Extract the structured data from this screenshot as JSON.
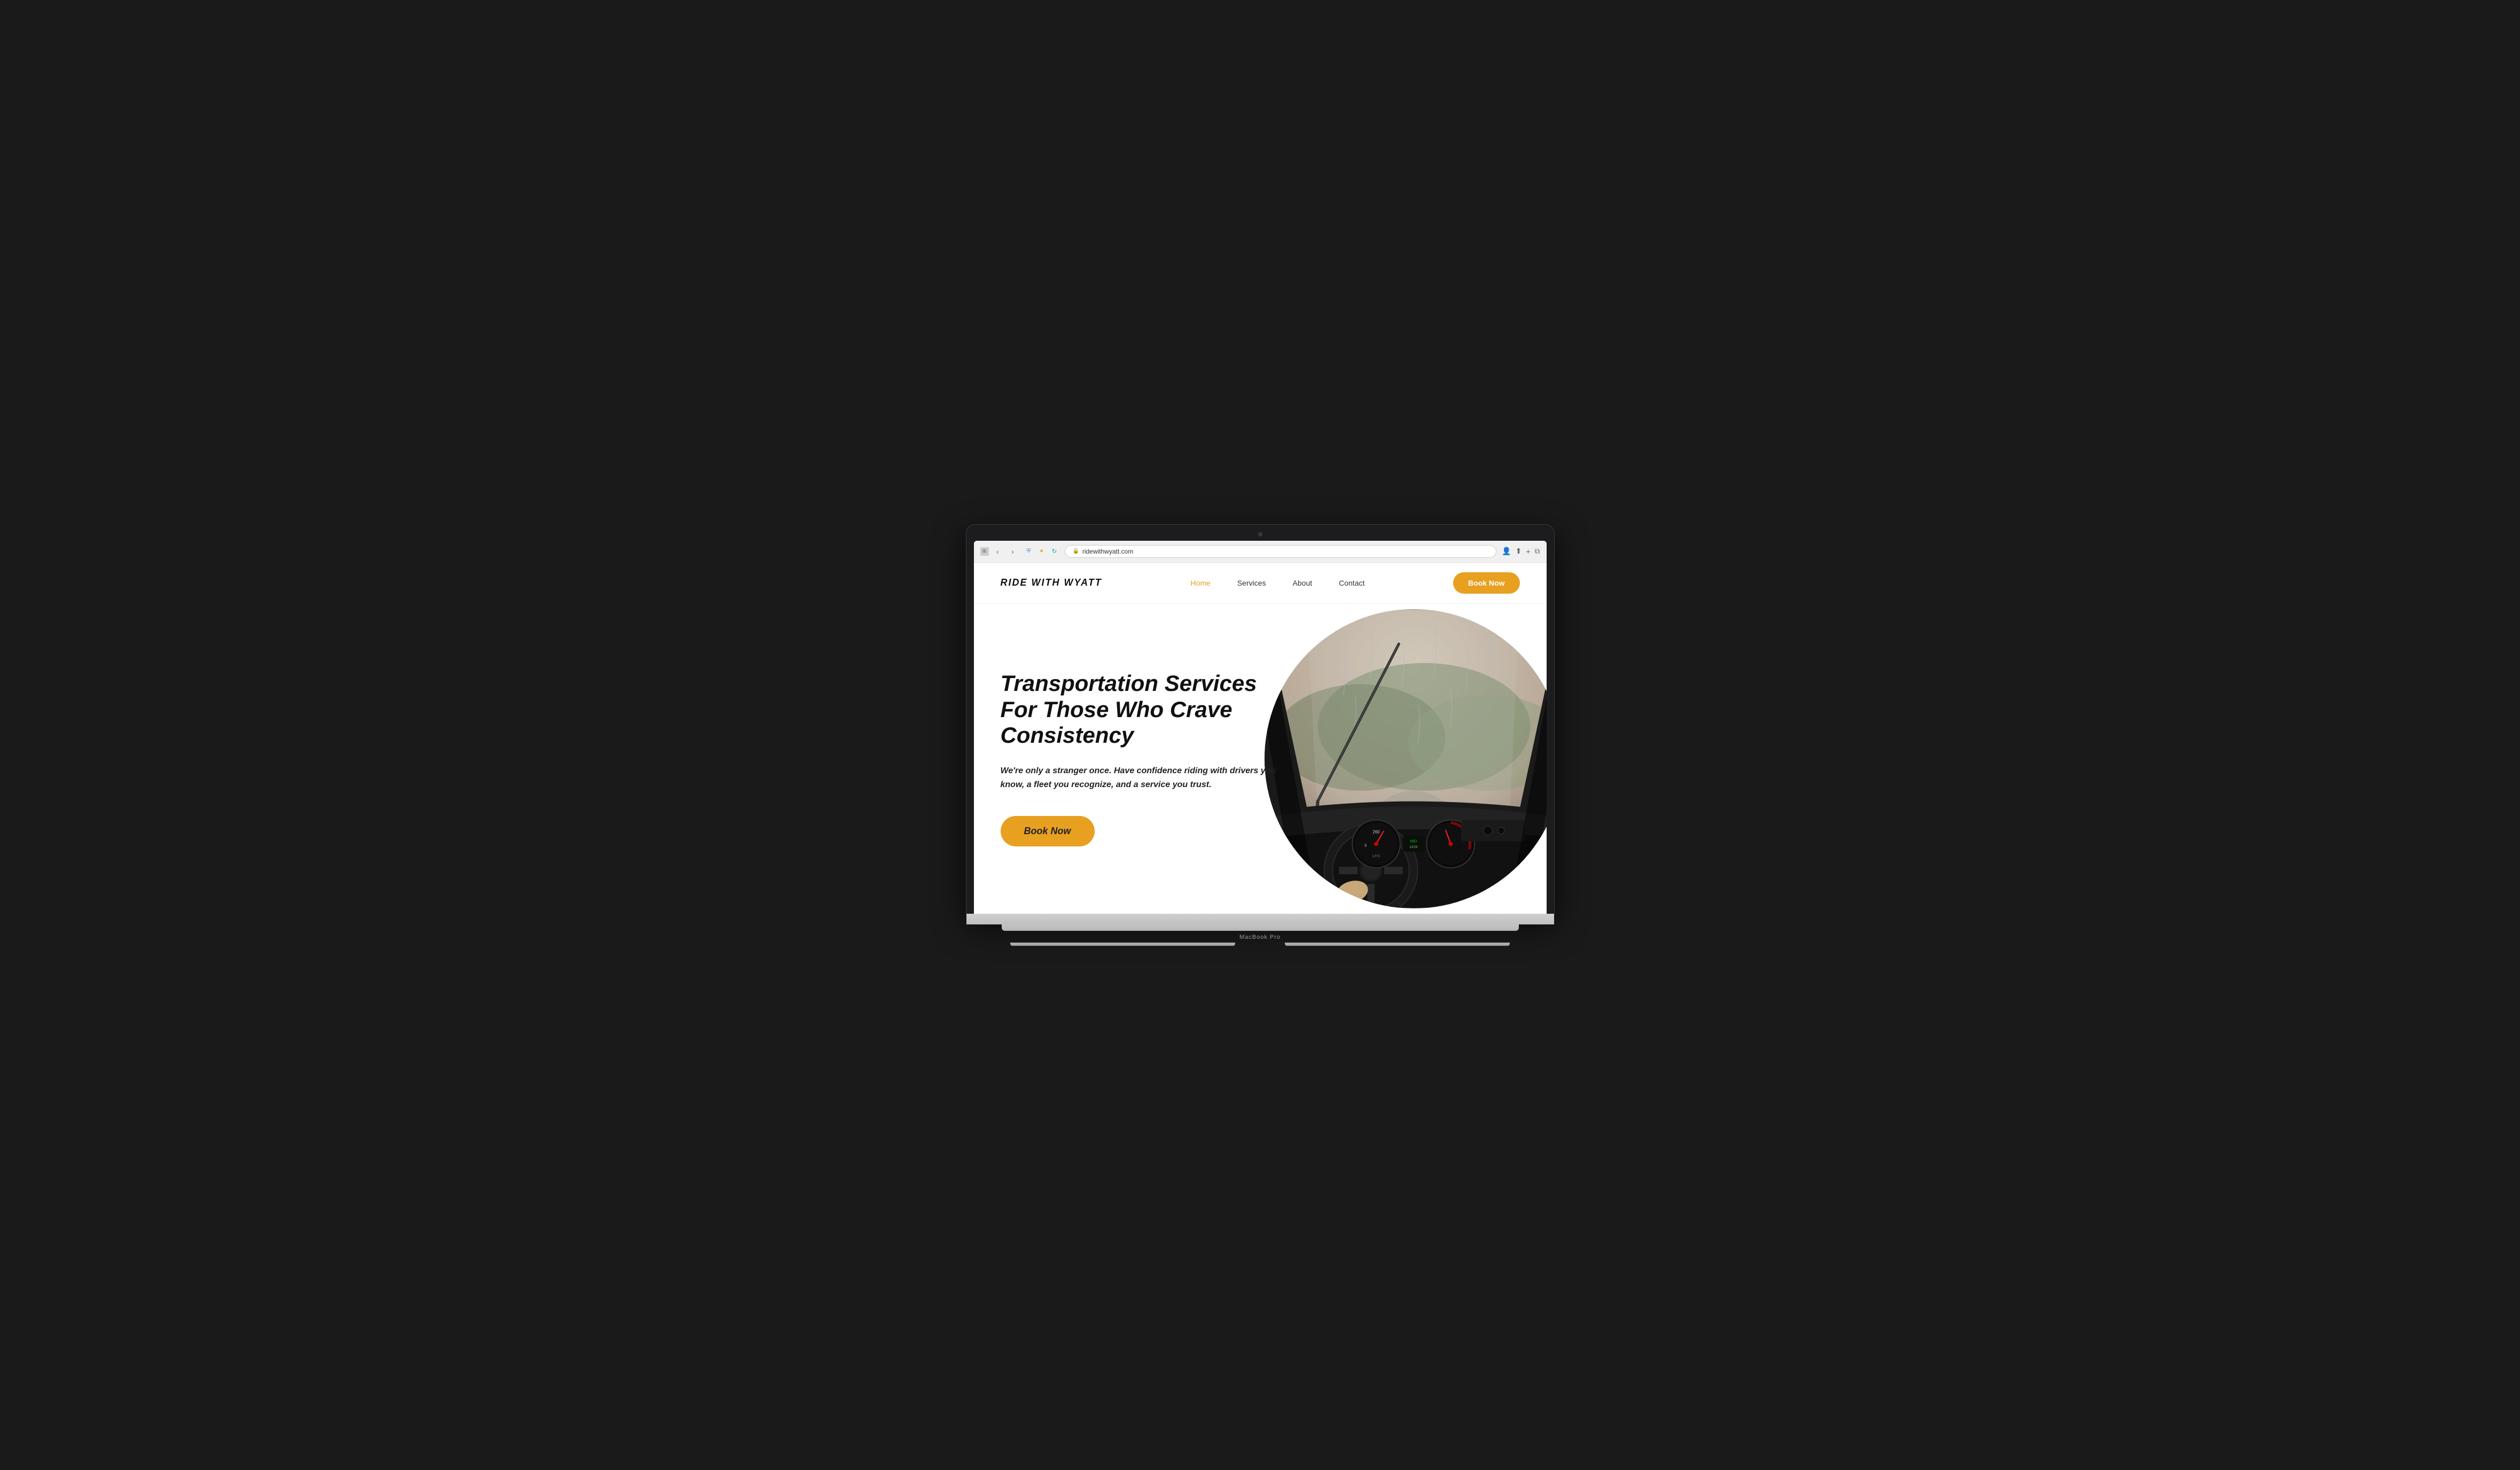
{
  "browser": {
    "url": "ridewithwyatt.com",
    "back_btn": "‹",
    "forward_btn": "›"
  },
  "nav": {
    "logo": "RIDE WITH WYATT",
    "links": [
      {
        "label": "Home",
        "active": true
      },
      {
        "label": "Services",
        "active": false
      },
      {
        "label": "About",
        "active": false
      },
      {
        "label": "Contact",
        "active": false
      }
    ],
    "book_btn": "Book Now"
  },
  "hero": {
    "title": "Transportation Services For Those Who Crave Consistency",
    "subtitle": "We're only a stranger once. Have confidence riding with drivers you know, a fleet you recognize, and a service you trust.",
    "cta_label": "Book Now"
  },
  "macbook": {
    "model_label": "MacBook Pro"
  },
  "colors": {
    "accent": "#e8a020",
    "text_dark": "#111111",
    "text_body": "#222222"
  }
}
